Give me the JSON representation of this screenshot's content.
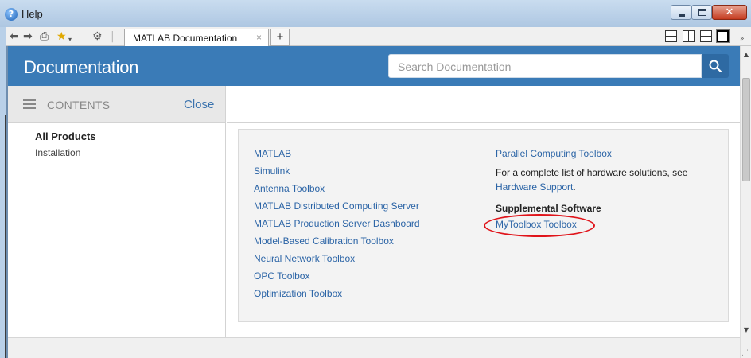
{
  "window": {
    "title": "Help"
  },
  "toolbar": {
    "icons": [
      "back-icon",
      "forward-icon",
      "print-icon",
      "favorites-star-icon",
      "settings-gear-icon"
    ],
    "tab_label": "MATLAB Documentation",
    "tab_close": "×",
    "new_tab": "+"
  },
  "header": {
    "title": "Documentation",
    "search_placeholder": "Search Documentation"
  },
  "contents": {
    "label": "CONTENTS",
    "close_label": "Close"
  },
  "sidebar": {
    "items": [
      "All Products",
      "Installation"
    ]
  },
  "products": {
    "left": [
      "MATLAB",
      "Simulink",
      "Antenna Toolbox",
      "MATLAB Distributed Computing Server",
      "MATLAB Production Server Dashboard",
      "Model-Based Calibration Toolbox",
      "Neural Network Toolbox",
      "OPC Toolbox",
      "Optimization Toolbox"
    ],
    "right_top": "Parallel Computing Toolbox",
    "hardware_note": "For a complete list of hardware solutions, see",
    "hardware_link": "Hardware Support",
    "hardware_period": ".",
    "supplemental_heading": "Supplemental Software",
    "supplemental_link": "MyToolbox Toolbox"
  },
  "colors": {
    "header_blue": "#3a7bb7",
    "link_blue": "#2b64a6",
    "highlight_red": "#e0141a"
  }
}
